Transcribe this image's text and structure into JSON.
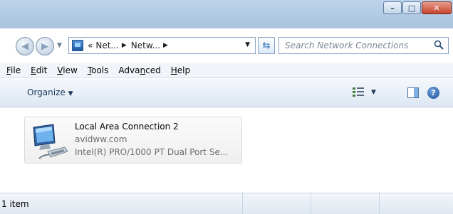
{
  "window": {
    "controls": {
      "minimize": "–",
      "maximize": "□",
      "close": "✕"
    }
  },
  "nav": {
    "back_icon": "back-arrow-icon",
    "forward_icon": "forward-arrow-icon",
    "history_dropdown_icon": "chevron-down-icon"
  },
  "address": {
    "overflow": "«",
    "crumbs": [
      "Net...",
      "Netw..."
    ],
    "refresh_icon": "refresh-icon"
  },
  "search": {
    "placeholder": "Search Network Connections"
  },
  "menu": {
    "items": [
      "File",
      "Edit",
      "View",
      "Tools",
      "Advanced",
      "Help"
    ],
    "underline_chars": [
      "F",
      "E",
      "V",
      "T",
      "n",
      "H"
    ]
  },
  "toolbar": {
    "organize_label": "Organize",
    "view_icon": "change-view-icon",
    "preview_pane_icon": "preview-pane-icon",
    "help_label": "?"
  },
  "content": {
    "items": [
      {
        "name": "Local Area Connection 2",
        "network": "avidww.com",
        "adapter": "Intel(R) PRO/1000 PT Dual Port Se...",
        "icon": "network-adapter-icon"
      }
    ]
  },
  "status": {
    "item_count": "1 item"
  },
  "colors": {
    "titlebar": "#bcd3ea",
    "close_button": "#c7432c",
    "link_text": "#1e395b"
  }
}
